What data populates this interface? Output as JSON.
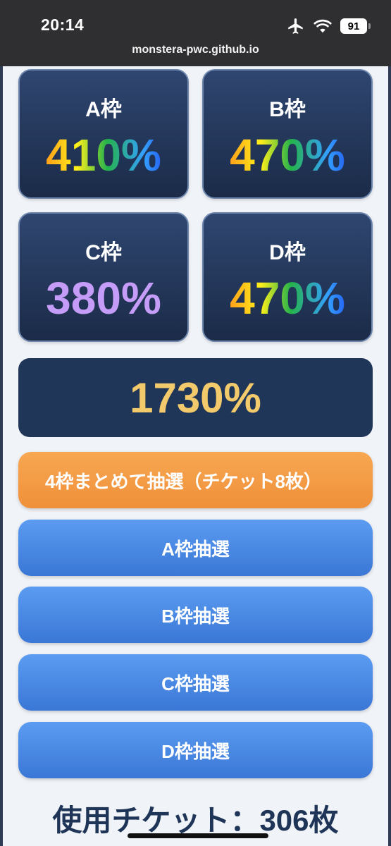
{
  "status_bar": {
    "time": "20:14",
    "battery": "91",
    "icons": [
      "airplane-icon",
      "wifi-icon",
      "battery-icon"
    ]
  },
  "browser": {
    "url": "monstera-pwc.github.io"
  },
  "slots": [
    {
      "label": "A枠",
      "value": "410%",
      "style": "rainbow"
    },
    {
      "label": "B枠",
      "value": "470%",
      "style": "rainbow"
    },
    {
      "label": "C枠",
      "value": "380%",
      "style": "purple"
    },
    {
      "label": "D枠",
      "value": "470%",
      "style": "rainbow"
    }
  ],
  "total": "1730%",
  "buttons": {
    "draw_all": "4枠まとめて抽選（チケット8枚）",
    "draw_a": "A枠抽選",
    "draw_b": "B枠抽選",
    "draw_c": "C枠抽選",
    "draw_d": "D枠抽選"
  },
  "tickets_used": "使用チケット：306枚",
  "colors": {
    "card_bg": "#233a60",
    "total_value": "#f2c96b",
    "orange_button": "#f39a43",
    "blue_button": "#4a88e4",
    "purple_value": "#c59cf7",
    "text_dark": "#1f3557"
  }
}
